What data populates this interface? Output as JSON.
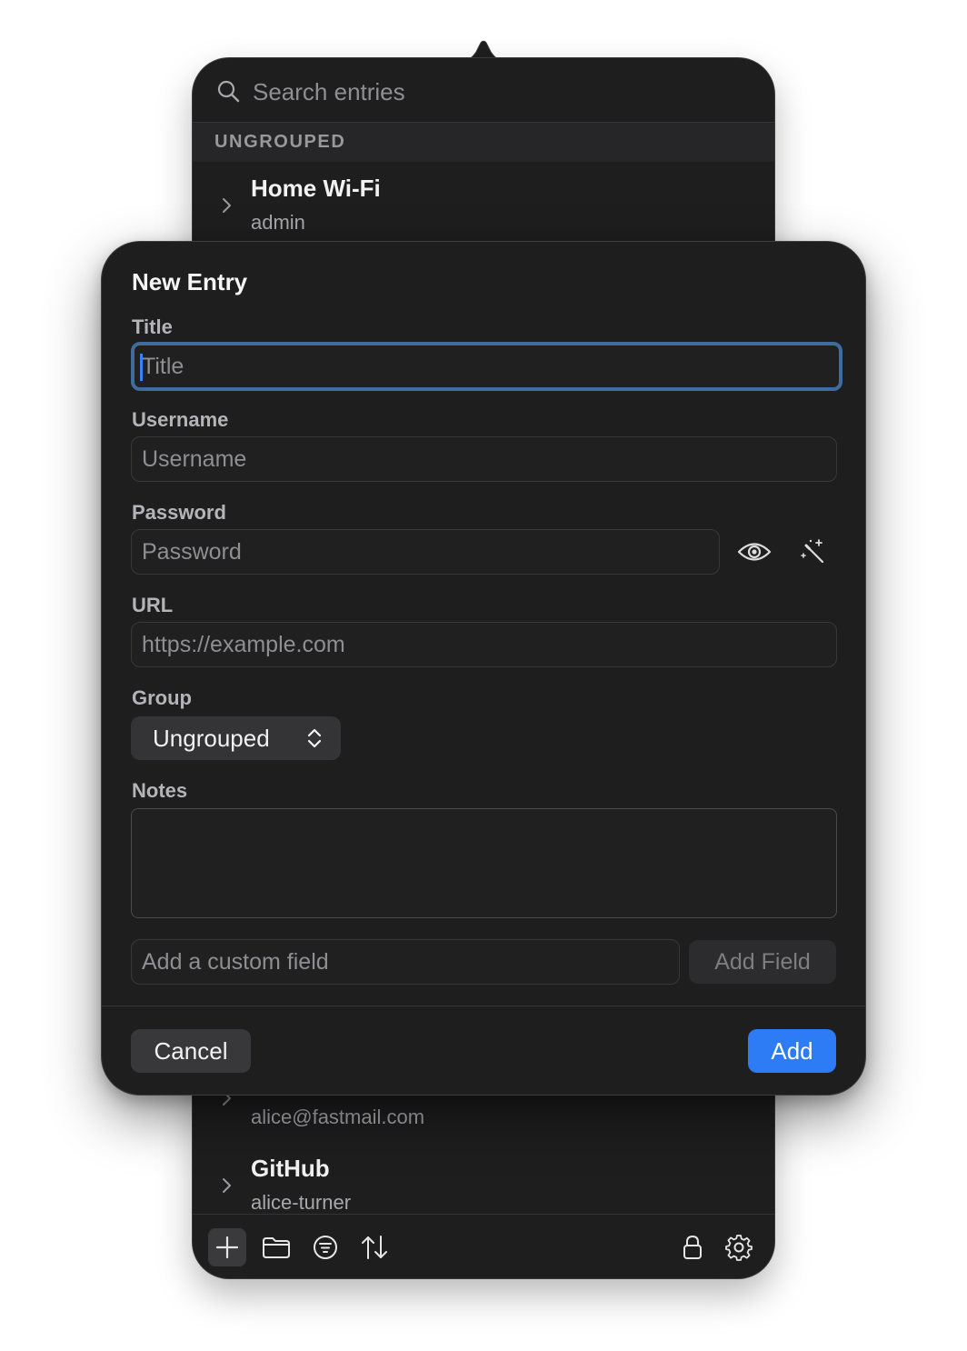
{
  "search": {
    "placeholder": "Search entries"
  },
  "list": {
    "group_header": "UNGROUPED",
    "entries": [
      {
        "title": "Home Wi-Fi",
        "subtitle": "admin"
      },
      {
        "title": "",
        "subtitle": "alice@fastmail.com"
      },
      {
        "title": "GitHub",
        "subtitle": "alice-turner"
      }
    ]
  },
  "toolbar": {
    "icons": [
      "plus-icon",
      "folder-icon",
      "filter-icon",
      "sort-icon",
      "lock-icon",
      "gear-icon"
    ]
  },
  "sheet": {
    "title": "New Entry",
    "fields": {
      "title": {
        "label": "Title",
        "placeholder": "Title",
        "value": ""
      },
      "username": {
        "label": "Username",
        "placeholder": "Username",
        "value": ""
      },
      "password": {
        "label": "Password",
        "placeholder": "Password",
        "value": ""
      },
      "url": {
        "label": "URL",
        "placeholder": "https://example.com",
        "value": ""
      },
      "group": {
        "label": "Group",
        "selected": "Ungrouped"
      },
      "notes": {
        "label": "Notes",
        "value": ""
      }
    },
    "custom_field": {
      "placeholder": "Add a custom field",
      "button_label": "Add Field"
    },
    "cancel_label": "Cancel",
    "add_label": "Add"
  },
  "colors": {
    "accent": "#2d7cf6",
    "focus_ring": "#3f6c9e",
    "background": "#1e1e1f"
  }
}
